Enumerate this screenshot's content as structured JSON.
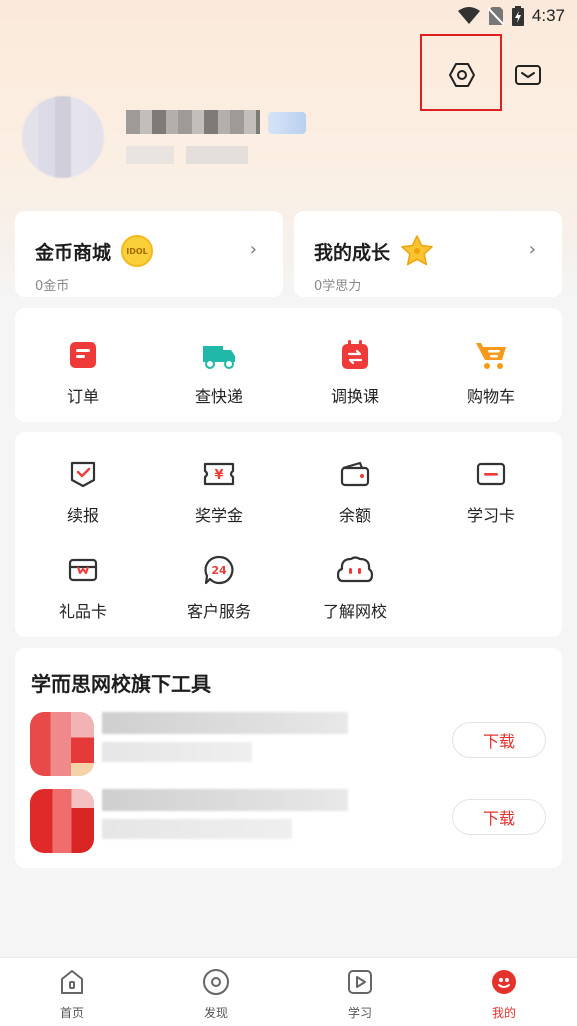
{
  "status_bar": {
    "time": "4:37"
  },
  "header": {
    "settings_icon": "settings-hexagon-icon",
    "message_icon": "mail-icon"
  },
  "cards": {
    "coins": {
      "title": "金币商城",
      "subtitle": "0金币",
      "badge": "IDOL"
    },
    "growth": {
      "title": "我的成长",
      "subtitle": "0学思力"
    }
  },
  "quick_menu": [
    {
      "label": "订单",
      "icon": "order-icon"
    },
    {
      "label": "查快递",
      "icon": "truck-icon"
    },
    {
      "label": "调换课",
      "icon": "calendar-swap-icon"
    },
    {
      "label": "购物车",
      "icon": "cart-icon"
    }
  ],
  "services": [
    {
      "label": "续报",
      "icon": "renew-icon"
    },
    {
      "label": "奖学金",
      "icon": "scholarship-icon"
    },
    {
      "label": "余额",
      "icon": "wallet-icon"
    },
    {
      "label": "学习卡",
      "icon": "study-card-icon"
    },
    {
      "label": "礼品卡",
      "icon": "gift-card-icon"
    },
    {
      "label": "客户服务",
      "icon": "customer-service-24-icon"
    },
    {
      "label": "了解网校",
      "icon": "chat-face-icon"
    }
  ],
  "tools": {
    "title": "学而思网校旗下工具",
    "items": [
      {
        "download_label": "下载"
      },
      {
        "download_label": "下载"
      }
    ]
  },
  "bottom_nav": [
    {
      "label": "首页",
      "icon": "home-icon"
    },
    {
      "label": "发现",
      "icon": "discover-icon"
    },
    {
      "label": "学习",
      "icon": "play-icon"
    },
    {
      "label": "我的",
      "icon": "mine-icon"
    }
  ],
  "colors": {
    "accent": "#e5322d",
    "teal": "#20b8a8",
    "orange": "#f79a1b"
  }
}
